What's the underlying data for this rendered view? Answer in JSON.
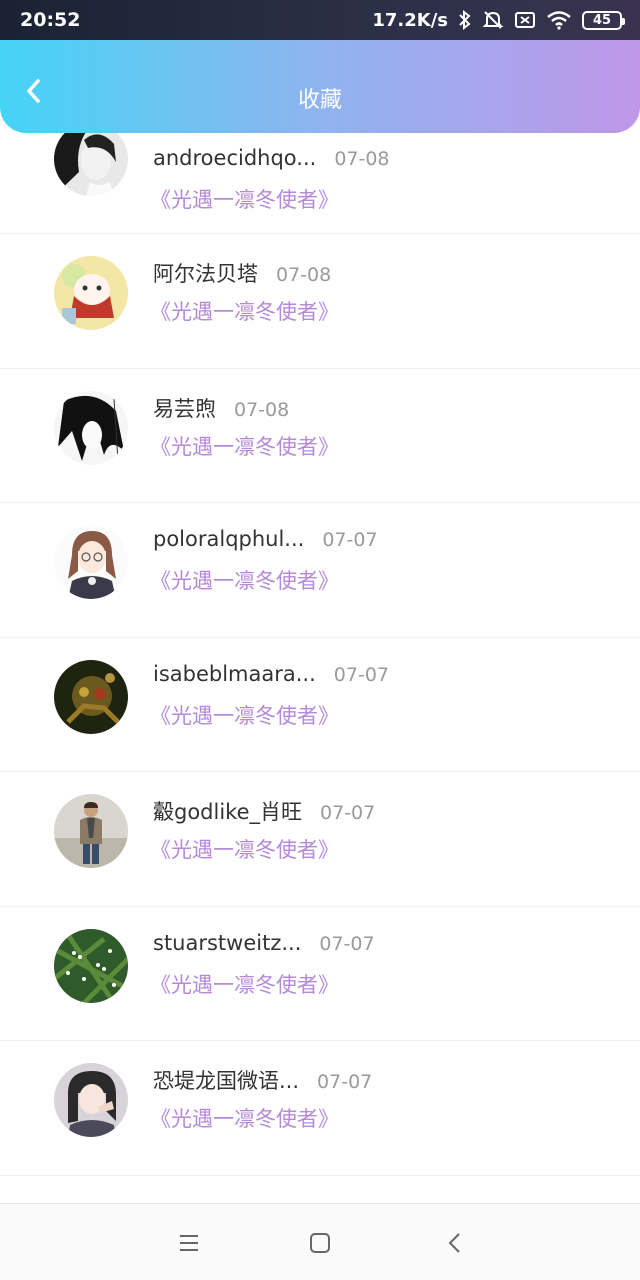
{
  "status_bar": {
    "time": "20:52",
    "net_speed": "17.2K/s",
    "battery": "45",
    "icons": [
      "bluetooth-icon",
      "mute-icon",
      "sim-off-icon",
      "wifi-icon",
      "battery-icon"
    ]
  },
  "header": {
    "title": "收藏",
    "back_icon": "chevron-left-icon"
  },
  "items": [
    {
      "name": "androecidhqo...",
      "date": "07-08",
      "work": "《光遇一凛冬使者》",
      "avatar": "avatar-bw-girl"
    },
    {
      "name": "阿尔法贝塔",
      "date": "07-08",
      "work": "《光遇一凛冬使者》",
      "avatar": "avatar-anime-red"
    },
    {
      "name": "易芸煦",
      "date": "07-08",
      "work": "《光遇一凛冬使者》",
      "avatar": "avatar-manga-bw"
    },
    {
      "name": "poloralqphul...",
      "date": "07-07",
      "work": "《光遇一凛冬使者》",
      "avatar": "avatar-anime-brown-hair"
    },
    {
      "name": "isabeblmaara...",
      "date": "07-07",
      "work": "《光遇一凛冬使者》",
      "avatar": "avatar-robot-dark"
    },
    {
      "name": "觳godlike_肖旺",
      "date": "07-07",
      "work": "《光遇一凛冬使者》",
      "avatar": "avatar-man-photo"
    },
    {
      "name": "stuarstweitz...",
      "date": "07-07",
      "work": "《光遇一凛冬使者》",
      "avatar": "avatar-green-flowers"
    },
    {
      "name": "恐堤龙国微语...",
      "date": "07-07",
      "work": "《光遇一凛冬使者》",
      "avatar": "avatar-girl-photo"
    }
  ],
  "nav_bar": {
    "icons": [
      "menu-icon",
      "home-square-icon",
      "back-triangle-icon"
    ]
  },
  "colors": {
    "header_start": "#45d4f5",
    "header_end": "#bf97e9",
    "work_title": "#b58ad9",
    "name": "#333333",
    "date": "#9a9a9a"
  }
}
